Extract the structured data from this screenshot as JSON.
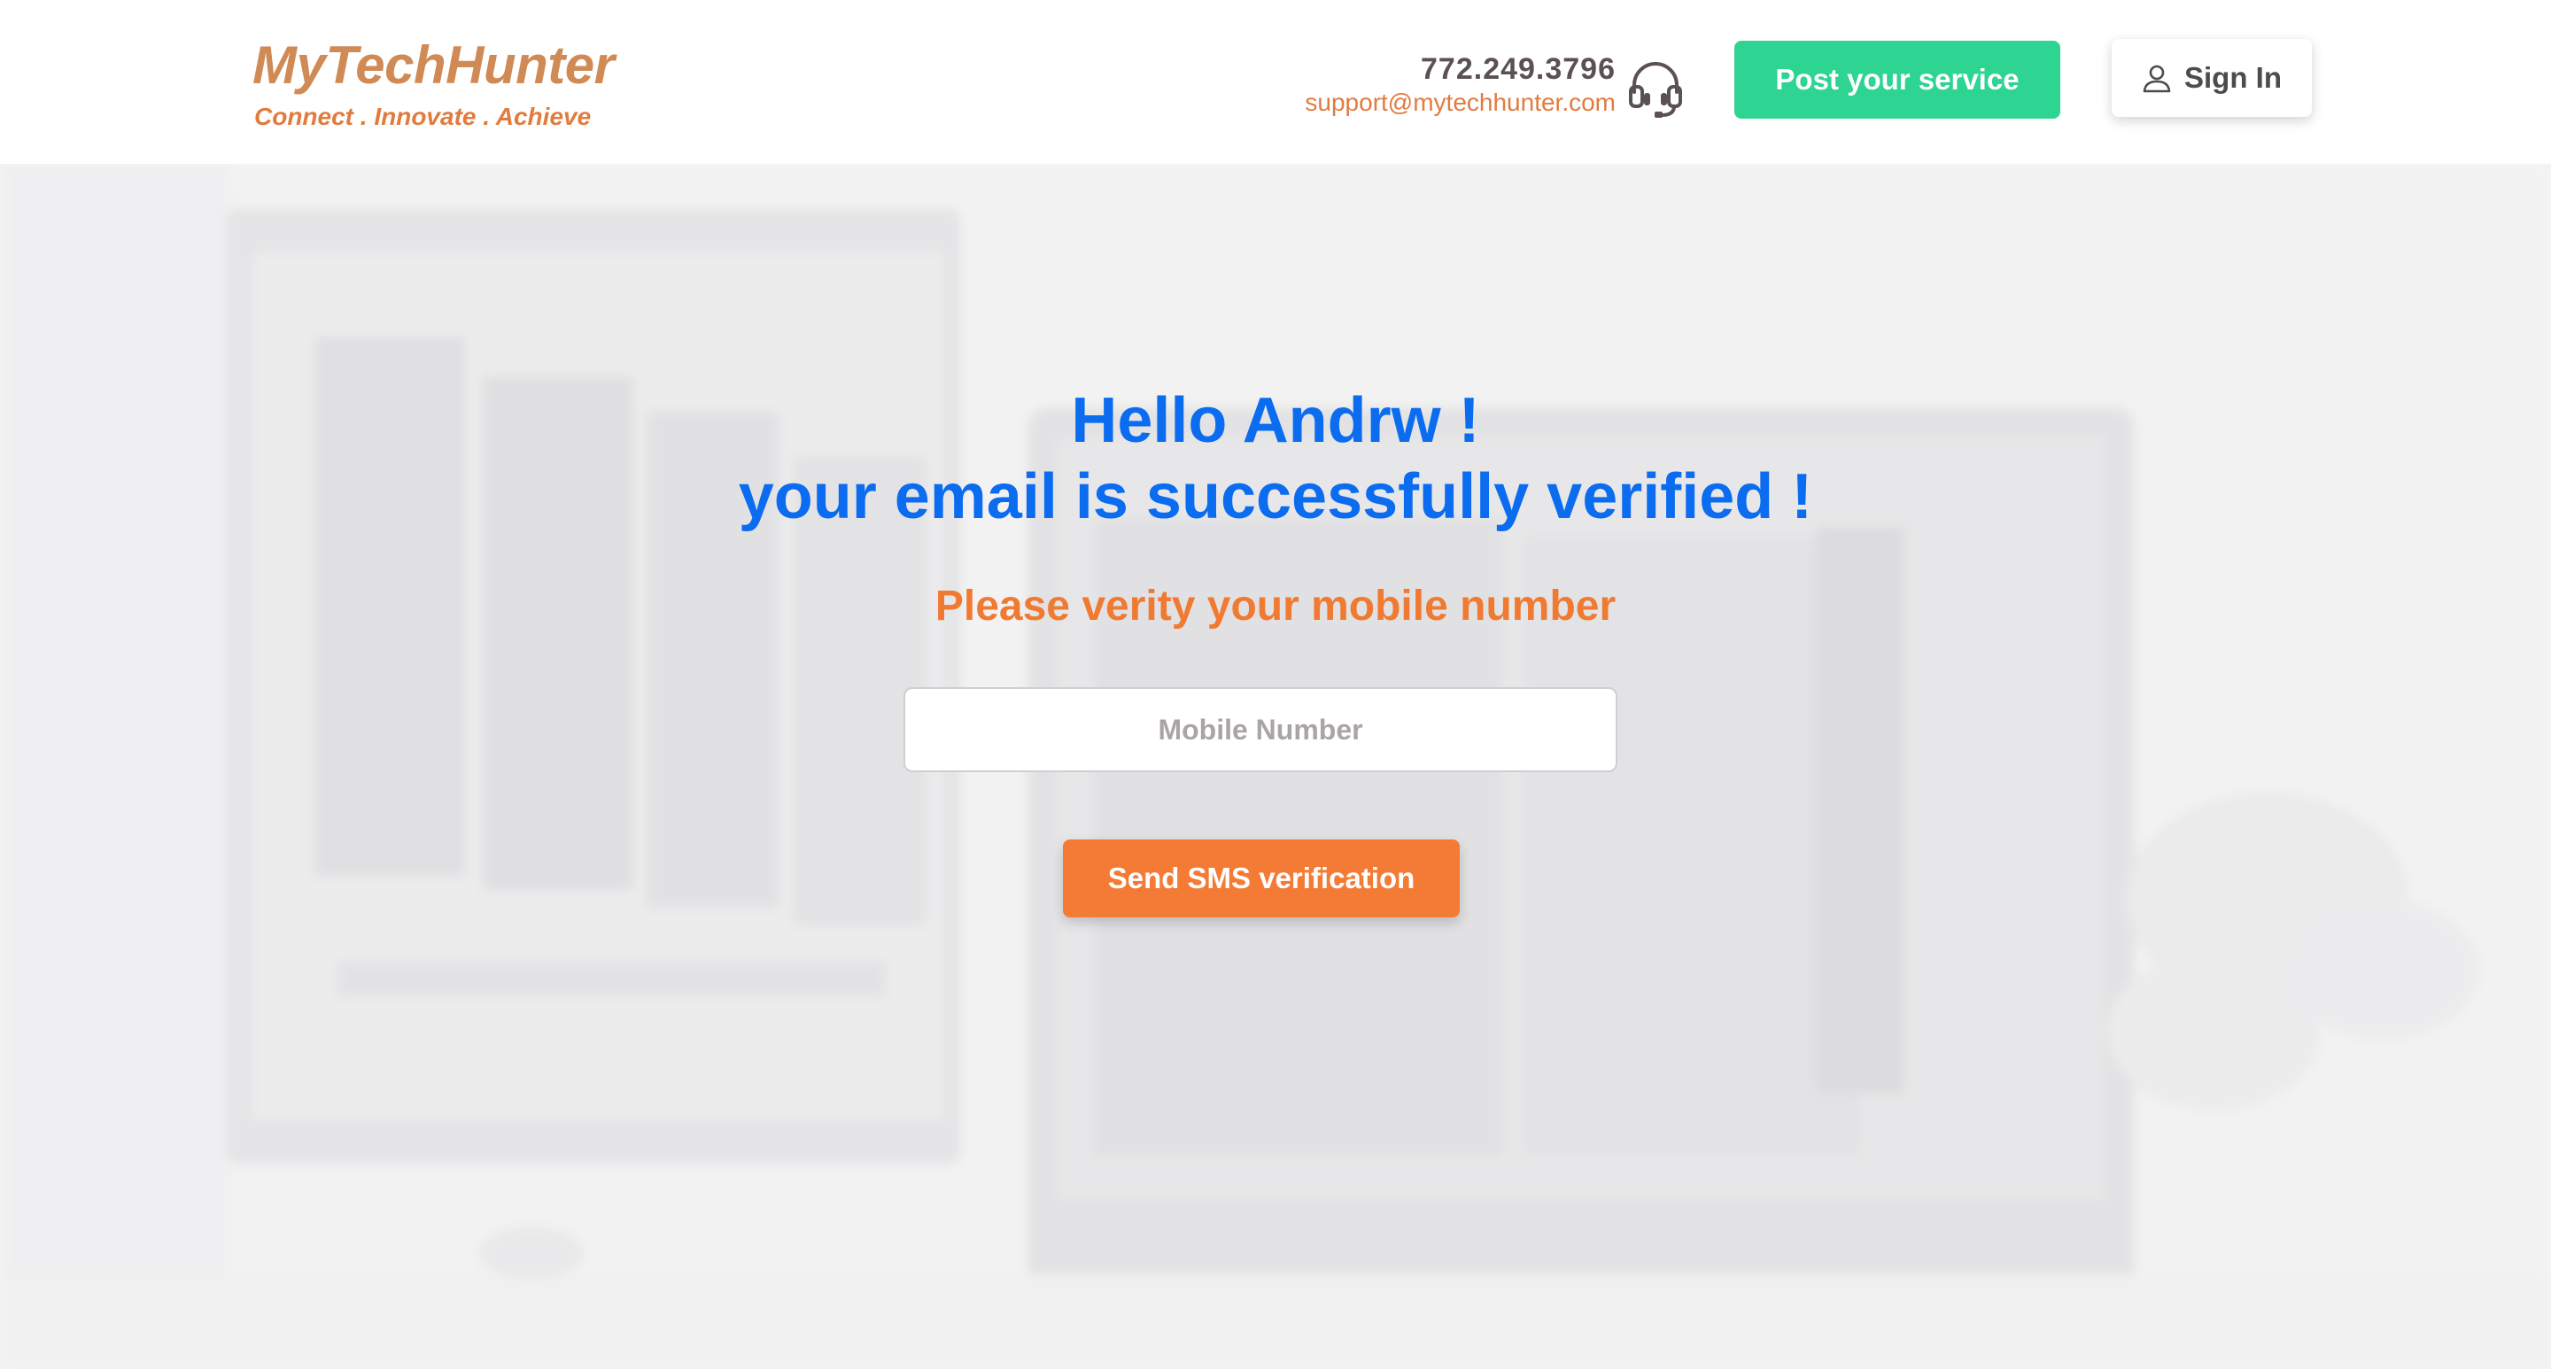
{
  "brand": {
    "name": "MyTechHunter",
    "tagline": "Connect . Innovate . Achieve"
  },
  "contact": {
    "phone": "772.249.3796",
    "email": "support@mytechhunter.com",
    "icon": "headset-icon"
  },
  "nav": {
    "post_label": "Post your service",
    "signin_label": "Sign In",
    "signin_icon": "user-icon"
  },
  "main": {
    "greeting": "Hello Andrw !",
    "verified_message": "your email is successfully verified !",
    "subtitle": "Please verity your mobile number",
    "mobile_placeholder": "Mobile Number",
    "mobile_value": "",
    "send_label": "Send SMS verification"
  },
  "colors": {
    "brand_orange": "#d08a55",
    "accent_orange": "#f47b35",
    "heading_blue": "#0b6cf0",
    "post_green": "#2dd492"
  }
}
